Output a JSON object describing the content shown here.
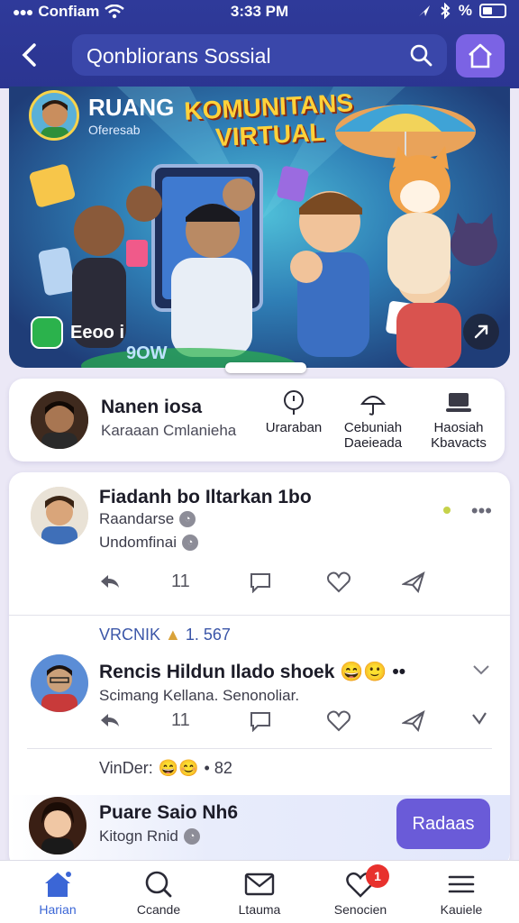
{
  "status_bar": {
    "carrier": "Confiam",
    "time": "3:33 PM",
    "battery_label": "%"
  },
  "header": {
    "search_text": "Qonbliorans Sossial"
  },
  "banner": {
    "title_line1": "RUANG",
    "title_line2": "KOMUNITANS VIRTUAL",
    "subtitle": "Oferesab",
    "tag_label": "Eeoo i",
    "bottom_text": "9OW"
  },
  "profile": {
    "name": "Nanen iosa",
    "subtitle": "Karaaan Cmlanieha",
    "actions": [
      {
        "label": "Uraraban",
        "icon": "location-pin-icon"
      },
      {
        "label": "Cebuniah Daeieada",
        "icon": "umbrella-icon"
      },
      {
        "label": "Haosiah Kbavacts",
        "icon": "laptop-icon"
      }
    ]
  },
  "feed": {
    "post1": {
      "title": "Fiadanh bo Iltarkan 1bo",
      "meta1": "Raandarse",
      "meta2": "Undomfinai",
      "count": "11"
    },
    "section_label": "VRCNIK",
    "section_count": "1. 567",
    "post2": {
      "title": "Rencis Hildun Ilado shoek",
      "subtitle": "Scimang Kellana. Senonoliar.",
      "count": "11"
    },
    "reaction_label": "VinDer:",
    "reaction_count": "• 82",
    "post3": {
      "title": "Puare Saio Nh6",
      "subtitle": "Kitogn Rnid",
      "button_label": "Radaas"
    }
  },
  "bottom_nav": {
    "items": [
      {
        "label": "Harian",
        "icon": "home-icon",
        "active": true
      },
      {
        "label": "Ccande",
        "icon": "search-icon",
        "active": false
      },
      {
        "label": "Ltauma",
        "icon": "mail-icon",
        "active": false
      },
      {
        "label": "Senocien",
        "icon": "heart-icon",
        "active": false,
        "badge": "1"
      },
      {
        "label": "Kauiele",
        "icon": "menu-icon",
        "active": false
      }
    ]
  },
  "colors": {
    "header": "#2f3a9a",
    "accent": "#7b63e4",
    "button": "#6a5bd8",
    "badge": "#e8312d",
    "active_nav": "#3b66d6"
  }
}
